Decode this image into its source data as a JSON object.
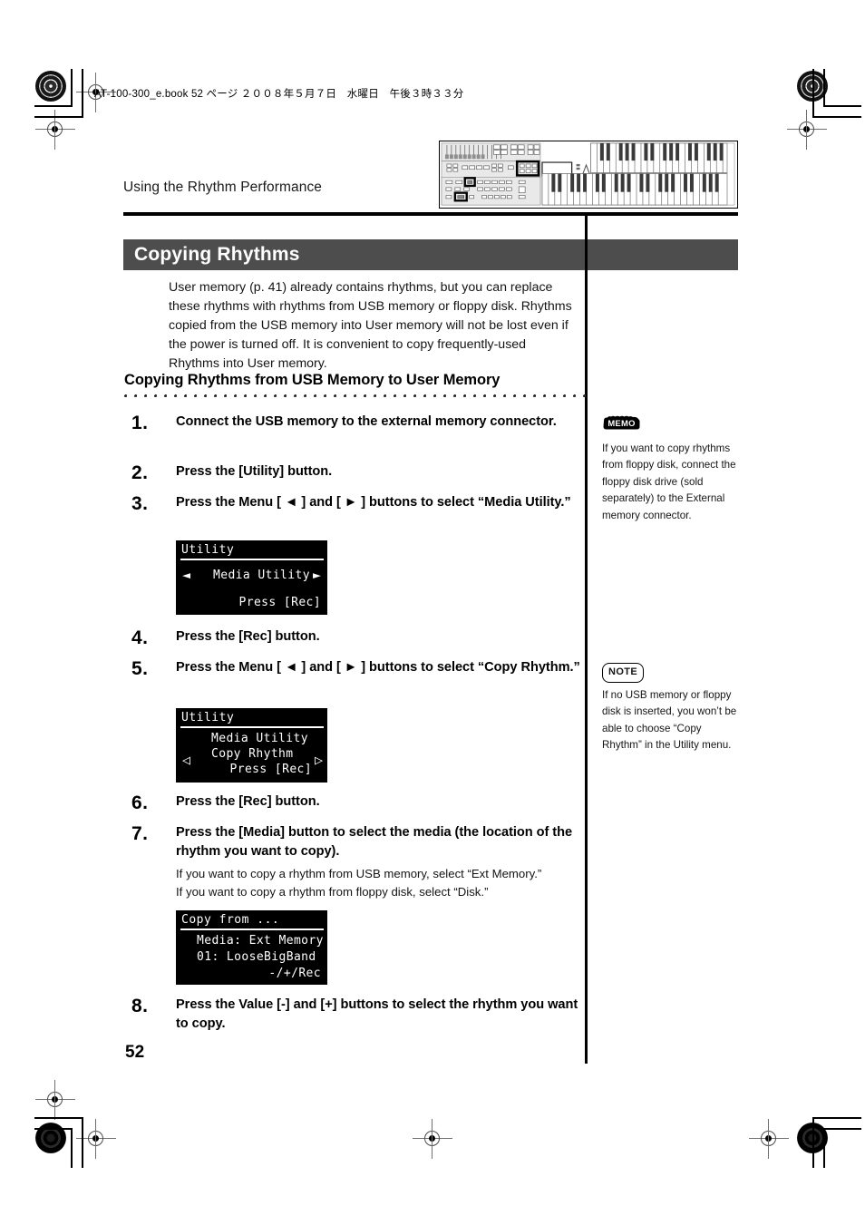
{
  "print_header": {
    "text": "AT-100-300_e.book  52 ページ  ２００８年５月７日　水曜日　午後３時３３分"
  },
  "running_head": {
    "chapter": "Using the Rhythm Performance"
  },
  "section": {
    "title": "Copying Rhythms",
    "title_bar_color": "#4d4d4d",
    "intro": "User memory (p. 41) already contains rhythms, but you can replace these rhythms with rhythms from USB memory or floppy disk. Rhythms copied from the USB memory into User memory will not be lost even if the power is turned off. It is convenient to copy frequently-used Rhythms into User memory.",
    "subheading": "Copying Rhythms from USB Memory to User Memory"
  },
  "steps": [
    {
      "num": "1.",
      "text": "Connect the USB memory to the external memory connector."
    },
    {
      "num": "2.",
      "text": "Press the [Utility] button."
    },
    {
      "num": "3.",
      "text": "Press the Menu [ ◄ ] and [ ► ] buttons to select “Media Utility.”"
    },
    {
      "num": "4.",
      "text": "Press the [Rec] button."
    },
    {
      "num": "5.",
      "text": "Press the Menu [ ◄ ] and [ ► ] buttons to select “Copy Rhythm.”"
    },
    {
      "num": "6.",
      "text": "Press the [Rec] button."
    },
    {
      "num": "7.",
      "text": "Press the [Media] button to select the media (the location of the rhythm you want to copy).",
      "sub_line_1": "If you want to copy a rhythm from USB memory, select “Ext Memory.”",
      "sub_line_2": "If you want to copy a rhythm from floppy disk, select “Disk.”"
    },
    {
      "num": "8.",
      "text": "Press the Value [-] and [+] buttons to select the rhythm you want to copy."
    }
  ],
  "lcd_screens": [
    {
      "id": "lcd-utility-media-utility",
      "title": "Utility",
      "center_line": "Media Utility",
      "footer_line": "Press [Rec]",
      "arrow_left": "◄",
      "arrow_right": "►"
    },
    {
      "id": "lcd-utility-copy-rhythm",
      "title": "Utility",
      "line_1": "Media Utility",
      "line_2": "Copy Rhythm",
      "footer_line": "Press [Rec]",
      "arrow_left": "◁",
      "arrow_right": "▷"
    },
    {
      "id": "lcd-copy-from",
      "title": "Copy from ...",
      "line_1": "Media: Ext Memory",
      "line_2": "01: LooseBigBand",
      "footer_line": "-/+/Rec"
    }
  ],
  "sidebar": {
    "memo": {
      "badge": "MEMO",
      "text": "If you want to copy rhythms from floppy disk, connect the floppy disk drive (sold separately) to the External memory connector."
    },
    "note": {
      "badge": "NOTE",
      "text": "If no USB memory or floppy disk is inserted, you won’t be able to choose “Copy Rhythm” in the Utility menu."
    }
  },
  "folio": {
    "page_number": "52"
  },
  "figure": {
    "caption": "organ-front-panel-illustration"
  }
}
